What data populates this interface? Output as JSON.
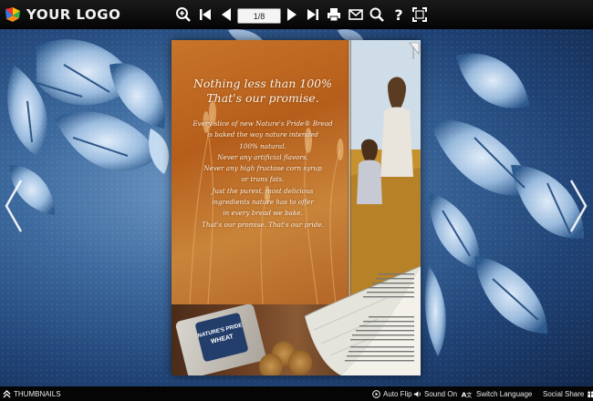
{
  "toolbar": {
    "logo_text": "YOUR LOGO",
    "page_indicator": "1/8",
    "icons": [
      "zoom-in-icon",
      "first-page-icon",
      "previous-page-icon",
      "next-page-icon",
      "last-page-icon",
      "print-icon",
      "email-icon",
      "search-icon",
      "help-icon",
      "fullscreen-icon"
    ]
  },
  "book": {
    "left_page": {
      "title_line1": "Nothing less than 100%",
      "title_line2": "That's our promise.",
      "lines": [
        "Every slice of new Nature's Pride® Bread",
        "is baked the way nature intended",
        "100% natural.",
        "Never any artificial flavors.",
        "Never any high fructose corn syrup",
        "or trans fats.",
        "Just the purest, most delicious",
        "ingredients nature has to offer",
        "in every bread we bake.",
        "That's our promise. That's our pride."
      ],
      "bread_label_line1": "NATURE'S PRIDE",
      "bread_label_line2": "WHEAT"
    }
  },
  "bottombar": {
    "thumbnails": "THUMBNAILS",
    "auto_flip": "Auto Flip",
    "sound_on": "Sound On",
    "switch_language": "Switch Language",
    "social_share": "Social Share"
  },
  "colors": {
    "toolbar_bg": "#0a0a0a",
    "background_blue": "#3d6a9e",
    "page_orange": "#b55e1b"
  }
}
